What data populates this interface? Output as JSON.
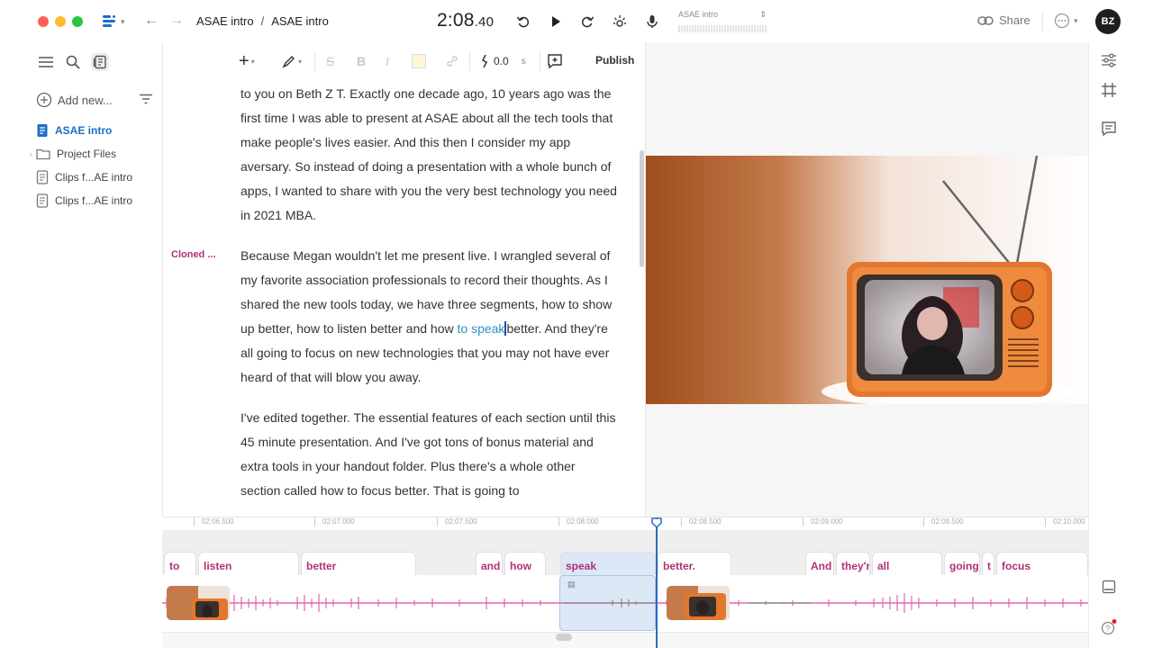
{
  "titlebar": {
    "breadcrumb": [
      "ASAE intro",
      "ASAE intro"
    ],
    "breadcrumb_sep": "/",
    "timecode_main": "2:08",
    "timecode_frac": ".40",
    "meter_label": "ASAE intro",
    "share_label": "Share",
    "avatar_initials": "BZ"
  },
  "sidebar": {
    "add_new_label": "Add new...",
    "items": [
      {
        "label": "ASAE intro",
        "icon": "document-icon",
        "active": true
      },
      {
        "label": "Project Files",
        "icon": "folder-icon",
        "active": false
      },
      {
        "label": "Clips f...AE intro",
        "icon": "document-icon",
        "active": false
      },
      {
        "label": "Clips f...AE intro",
        "icon": "document-icon",
        "active": false
      }
    ]
  },
  "toolbar": {
    "speed_value": "0.0",
    "speed_unit": "s",
    "publish_label": "Publish"
  },
  "editor": {
    "speaker_label": "Cloned ...",
    "para1": "to you on Beth Z T. Exactly one decade ago, 10 years ago was the first time I was able to present at ASAE about all the tech tools that make people's lives easier. And this then I consider my app aversary. So instead of doing a presentation with a whole bunch of apps, I wanted to share with you the very best technology you need in 2021 MBA.",
    "para2_before": "Because Megan wouldn't let me present live. I wrangled several of my favorite association professionals to record their thoughts. As I shared the new tools today, we have three segments, how to show up better, how to listen better and how ",
    "para2_highlight": "to speak",
    "para2_after": "better. And they're all going to focus on new technologies that you may not have ever heard of that will blow you away.",
    "para3": "I've edited together. The essential features of each section until this 45 minute presentation. And I've got tons of bonus material and extra tools in your handout folder. Plus there's a whole other section called how to focus better. That is going to"
  },
  "timeline": {
    "ticks": [
      "02:06.500",
      "02:07.000",
      "02:07.500",
      "02:08.000",
      "02:08.500",
      "02:09.000",
      "02:09.500",
      "02:10.000"
    ],
    "words": [
      "to",
      "listen",
      "better",
      "and",
      "how",
      "speak",
      "better.",
      "And",
      "they'r",
      "all",
      "going",
      "t",
      "focus"
    ]
  },
  "colors": {
    "accent_blue": "#1a6fc8",
    "word_magenta": "#b0307a",
    "waveform_pink": "#e066b0",
    "selection_blue": "#dde8f6"
  }
}
